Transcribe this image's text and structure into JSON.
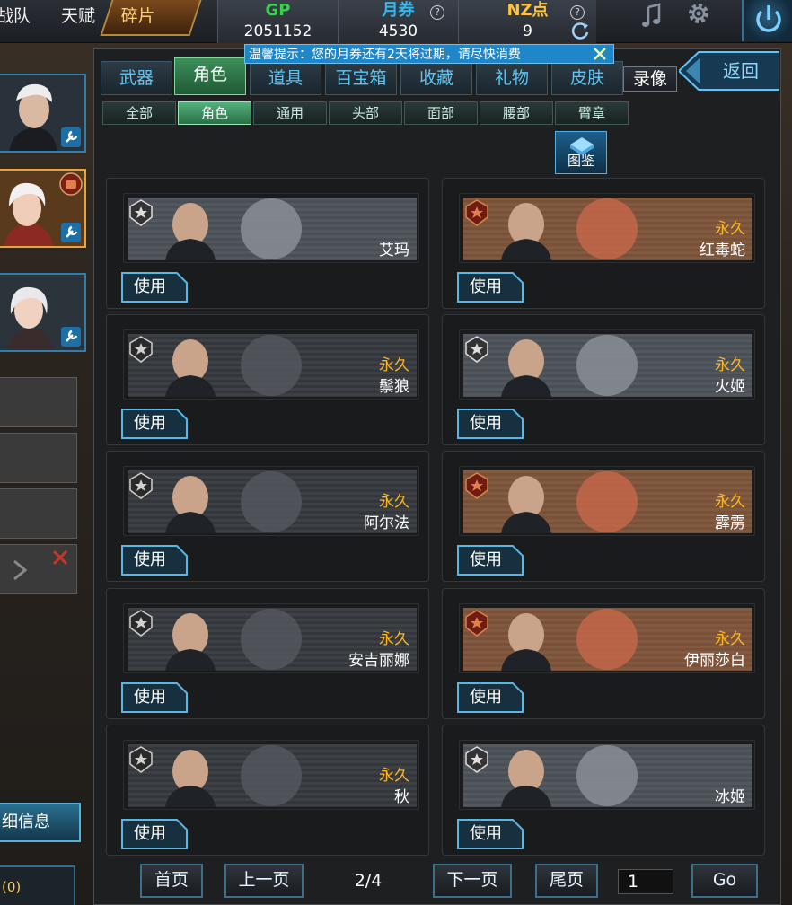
{
  "topbar": {
    "tabs": [
      {
        "label": "战队"
      },
      {
        "label": "天赋"
      },
      {
        "label": "碎片"
      }
    ],
    "currencies": [
      {
        "name": "GP",
        "value": "2051152",
        "color": "#3ccf4e"
      },
      {
        "name": "月券",
        "value": "4530",
        "color": "#33b7f0"
      },
      {
        "name": "NZ点",
        "value": "9",
        "color": "#ffc43d"
      }
    ],
    "help_glyph": "?"
  },
  "notice": {
    "text": "温馨提示：您的月券还有2天将过期，请尽快消费"
  },
  "sidebar": {
    "detail_label": "细信息",
    "detail_count": "(0)"
  },
  "main_tabs": [
    {
      "label": "武器"
    },
    {
      "label": "角色"
    },
    {
      "label": "道具"
    },
    {
      "label": "百宝箱"
    },
    {
      "label": "收藏"
    },
    {
      "label": "礼物"
    },
    {
      "label": "皮肤"
    }
  ],
  "record_label": "录像",
  "back_label": "返回",
  "sub_tabs": [
    {
      "label": "全部"
    },
    {
      "label": "角色"
    },
    {
      "label": "通用"
    },
    {
      "label": "头部"
    },
    {
      "label": "面部"
    },
    {
      "label": "腰部"
    },
    {
      "label": "臂章"
    }
  ],
  "catalog_label": "图鉴",
  "items": [
    {
      "name": "艾玛",
      "duration": "",
      "use_label": "使用",
      "banner": "silver-star"
    },
    {
      "name": "红毒蛇",
      "duration": "永久",
      "use_label": "使用",
      "banner": "bronze-fist"
    },
    {
      "name": "鬃狼",
      "duration": "永久",
      "use_label": "使用",
      "banner": "dark-sword"
    },
    {
      "name": "火姬",
      "duration": "永久",
      "use_label": "使用",
      "banner": "silver-star"
    },
    {
      "name": "阿尔法",
      "duration": "永久",
      "use_label": "使用",
      "banner": "dark-sword"
    },
    {
      "name": "霹雳",
      "duration": "永久",
      "use_label": "使用",
      "banner": "bronze-fist"
    },
    {
      "name": "安吉丽娜",
      "duration": "永久",
      "use_label": "使用",
      "banner": "dark-sword"
    },
    {
      "name": "伊丽莎白",
      "duration": "永久",
      "use_label": "使用",
      "banner": "bronze-fist"
    },
    {
      "name": "秋",
      "duration": "永久",
      "use_label": "使用",
      "banner": "dark-sword"
    },
    {
      "name": "冰姬",
      "duration": "",
      "use_label": "使用",
      "banner": "silver-star"
    }
  ],
  "pagination": {
    "first": "首页",
    "prev": "上一页",
    "info": "2/4",
    "next": "下一页",
    "last": "尾页",
    "page_input": "1",
    "go": "Go"
  }
}
